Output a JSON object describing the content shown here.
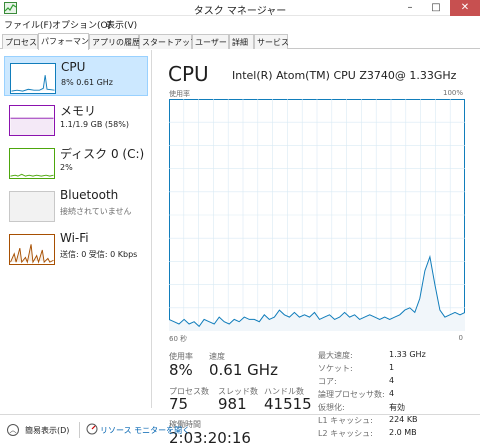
{
  "window": {
    "title": "タスク マネージャー",
    "minimize": "–",
    "maximize": "□",
    "close": "✕"
  },
  "menu": [
    "ファイル(F)",
    "オプション(O)",
    "表示(V)"
  ],
  "tabs": [
    "プロセス",
    "パフォーマンス",
    "アプリの履歴",
    "スタートアップ",
    "ユーザー",
    "詳細",
    "サービス"
  ],
  "active_tab": "パフォーマンス",
  "sidebar": [
    {
      "title": "CPU",
      "sub": "8% 0.61 GHz",
      "color": "#117dbb"
    },
    {
      "title": "メモリ",
      "sub": "1.1/1.9 GB (58%)",
      "color": "#8b12ae"
    },
    {
      "title": "ディスク 0 (C:)",
      "sub": "2%",
      "color": "#4da60c"
    },
    {
      "title": "Bluetooth",
      "sub": "接続されていません",
      "color": "#a0a0a0"
    },
    {
      "title": "Wi-Fi",
      "sub": "送信: 0 受信: 0 Kbps",
      "color": "#a74f01"
    }
  ],
  "main": {
    "title": "CPU",
    "cpu_name": "Intel(R) Atom(TM) CPU Z3740@ 1.33GHz",
    "util_label": "使用率",
    "max_label": "100%",
    "time_label": "60 秒",
    "min_label": "0"
  },
  "chart_data": {
    "type": "area",
    "x_range": [
      60,
      0
    ],
    "ylim": [
      0,
      100
    ],
    "values": [
      5,
      4,
      3,
      5,
      3,
      4,
      2,
      5,
      4,
      3,
      6,
      4,
      3,
      5,
      4,
      6,
      5,
      5,
      4,
      7,
      5,
      6,
      9,
      7,
      6,
      8,
      6,
      7,
      6,
      8,
      5,
      6,
      7,
      5,
      6,
      8,
      6,
      7,
      5,
      6,
      7,
      6,
      5,
      6,
      5,
      6,
      7,
      9,
      10,
      8,
      14,
      26,
      32,
      20,
      9,
      6,
      7,
      8,
      7,
      8
    ],
    "line_color": "#117dbb",
    "fill_color": "#f1f6fa",
    "grid_color": "#d9eaf4"
  },
  "stats": {
    "usage_label": "使用率",
    "usage_value": "8%",
    "speed_label": "速度",
    "speed_value": "0.61 GHz",
    "processes_label": "プロセス数",
    "processes_value": "75",
    "threads_label": "スレッド数",
    "threads_value": "981",
    "handles_label": "ハンドル数",
    "handles_value": "41515",
    "uptime_label": "稼働時間",
    "uptime_value": "2:03:20:16"
  },
  "specs": [
    {
      "label": "最大速度:",
      "value": "1.33 GHz"
    },
    {
      "label": "ソケット:",
      "value": "1"
    },
    {
      "label": "コア:",
      "value": "4"
    },
    {
      "label": "論理プロセッサ数:",
      "value": "4"
    },
    {
      "label": "仮想化:",
      "value": "有効"
    },
    {
      "label": "L1 キャッシュ:",
      "value": "224 KB"
    },
    {
      "label": "L2 キャッシュ:",
      "value": "2.0 MB"
    }
  ],
  "footer": {
    "fewer_details": "簡易表示(D)",
    "open_resmon": "リソース モニターを開く"
  }
}
